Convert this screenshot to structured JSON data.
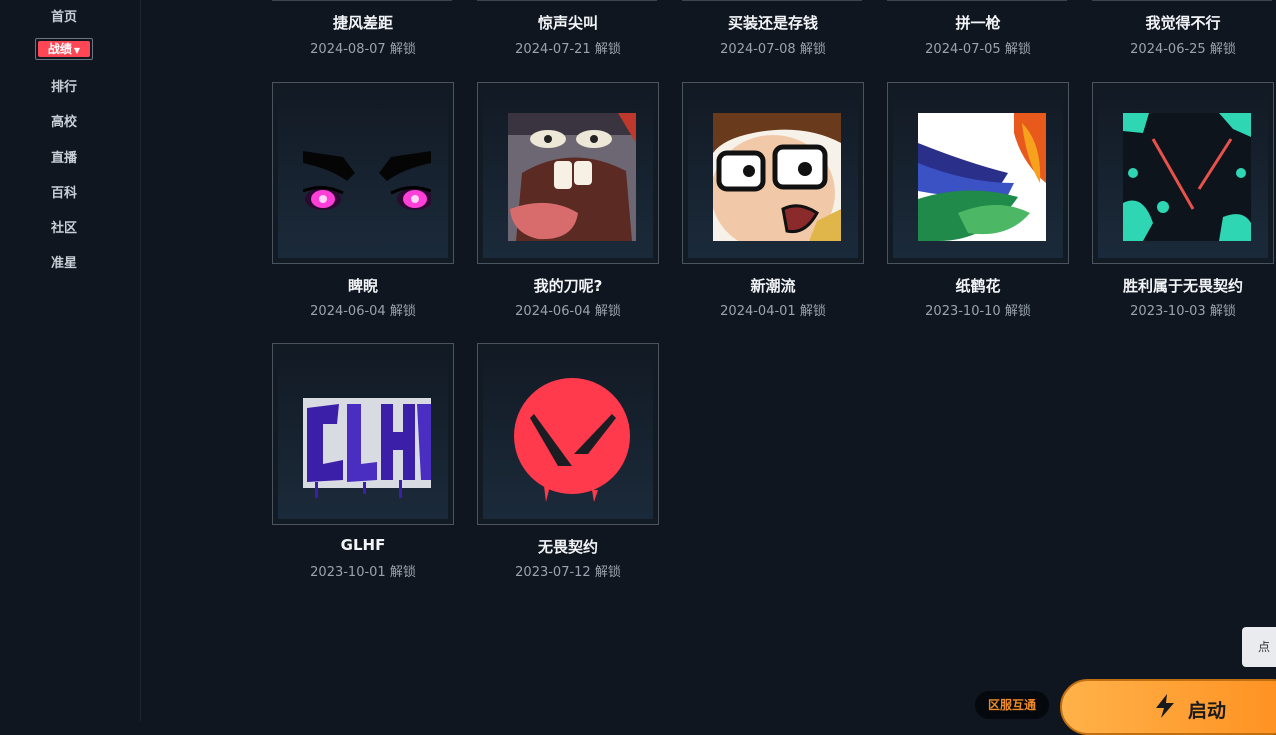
{
  "sidebar": {
    "items": [
      {
        "label": "首页"
      },
      {
        "label": "战绩"
      },
      {
        "label": "排行"
      },
      {
        "label": "高校"
      },
      {
        "label": "直播"
      },
      {
        "label": "百科"
      },
      {
        "label": "社区"
      },
      {
        "label": "准星"
      }
    ],
    "active_index": 1
  },
  "sprays": {
    "row0": [
      {
        "title": "捷风差距",
        "date": "2024-08-07 解锁"
      },
      {
        "title": "惊声尖叫",
        "date": "2024-07-21 解锁"
      },
      {
        "title": "买装还是存钱",
        "date": "2024-07-08 解锁"
      },
      {
        "title": "拼一枪",
        "date": "2024-07-05 解锁"
      },
      {
        "title": "我觉得不行",
        "date": "2024-06-25 解锁"
      }
    ],
    "row1": [
      {
        "title": "睥睨",
        "date": "2024-06-04 解锁",
        "icon": "purple-eyes-icon"
      },
      {
        "title": "我的刀呢?",
        "date": "2024-06-04 解锁",
        "icon": "screaming-creature-icon"
      },
      {
        "title": "新潮流",
        "date": "2024-04-01 解锁",
        "icon": "glasses-face-icon"
      },
      {
        "title": "纸鹤花",
        "date": "2023-10-10 解锁",
        "icon": "paper-crane-flower-icon"
      },
      {
        "title": "胜利属于无畏契约",
        "date": "2023-10-03 解锁",
        "icon": "teal-v-logo-icon"
      }
    ],
    "row2": [
      {
        "title": "GLHF",
        "date": "2023-10-01 解锁",
        "icon": "glhf-graffiti-icon"
      },
      {
        "title": "无畏契约",
        "date": "2023-07-12 解锁",
        "icon": "valorant-logo-icon"
      }
    ]
  },
  "floating": {
    "hint_text": "点",
    "region_label": "区服互通",
    "launch_label": "启动"
  },
  "colors": {
    "background": "#0f1620",
    "accent_red": "#ff4655",
    "launch_orange": "#ff9a2e"
  }
}
